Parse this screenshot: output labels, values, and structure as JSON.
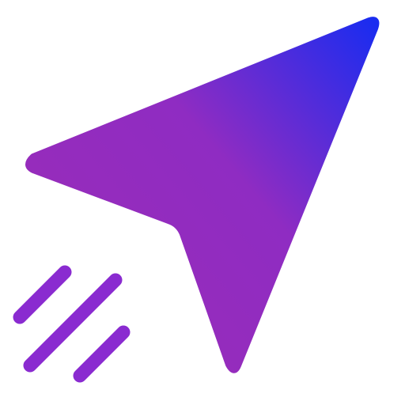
{
  "icon": {
    "name": "paper-plane-send-icon",
    "colors": {
      "gradient_start": "#9a2cb8",
      "gradient_mid": "#8f2cc2",
      "gradient_end": "#1a2cf0",
      "speed_lines": "#8a2bd0"
    },
    "speed_lines_count": 3
  }
}
